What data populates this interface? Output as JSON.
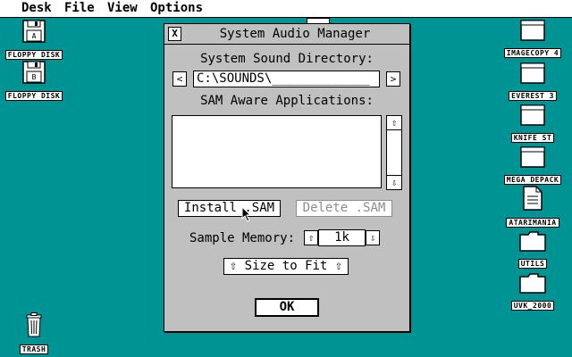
{
  "menubar": {
    "items": [
      "Desk",
      "File",
      "View",
      "Options"
    ]
  },
  "desktop": {
    "left_icons": [
      {
        "label": "FLOPPY DISK",
        "drive": "A"
      },
      {
        "label": "FLOPPY DISK",
        "drive": "B"
      }
    ],
    "right_icons": [
      {
        "label": "IMAGECOPY 4"
      },
      {
        "label": "EVEREST 3"
      },
      {
        "label": "KNIFE ST"
      },
      {
        "label": "MEGA DEPACK"
      },
      {
        "label": "ATARIMANIA"
      },
      {
        "label": "UTILS"
      },
      {
        "label": "UVK_2000"
      }
    ],
    "trash": {
      "label": "TRASH"
    }
  },
  "dialog": {
    "close_glyph": "X",
    "title": "System Audio Manager",
    "sound_dir_label": "System Sound Directory:",
    "prev_glyph": "<",
    "next_glyph": ">",
    "sound_dir_value": "C:\\SOUNDS\\_____________",
    "apps_label": "SAM Aware Applications:",
    "scroll_up_glyph": "⇧",
    "scroll_down_glyph": "⇩",
    "install_label": "Install .SAM",
    "delete_label": "Delete .SAM",
    "sample_memory_label": "Sample Memory:",
    "memory_up_glyph": "⇧",
    "memory_value": "1k",
    "memory_down_glyph": "⇩",
    "size_to_fit_label": "⇧ Size to Fit ⇧",
    "ok_label": "OK"
  }
}
